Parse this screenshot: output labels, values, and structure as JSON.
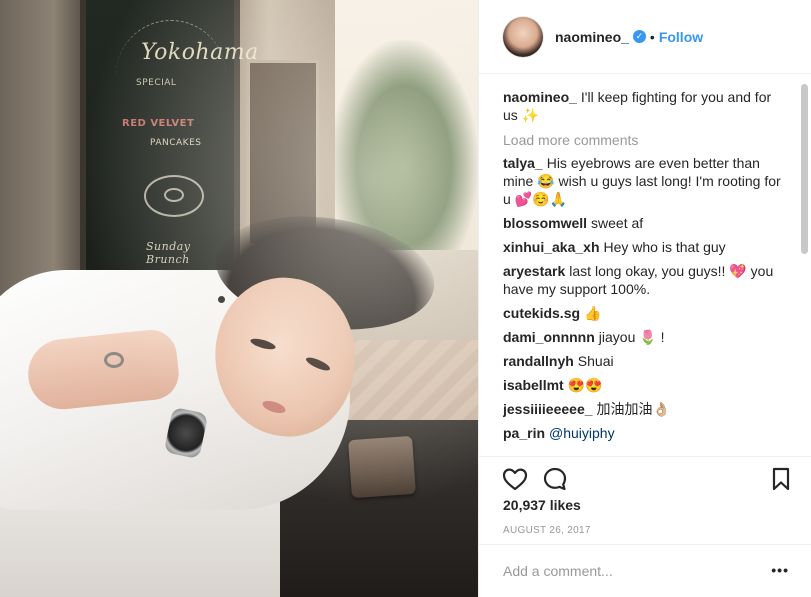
{
  "post": {
    "username": "naomineo_",
    "verified_icon": "verified-badge-icon",
    "separator": "•",
    "follow_label": "Follow"
  },
  "photo": {
    "chalkboard_title": "Yokohama",
    "chalkboard_sub": "SPECIAL",
    "chalkboard_red": "RED VELVET",
    "chalkboard_pancakes": "PANCAKES",
    "chalkboard_sign": "Sunday Brunch"
  },
  "caption": {
    "username": "naomineo_",
    "text": "I'll keep fighting for you and for us ✨"
  },
  "load_more_label": "Load more comments",
  "comments": [
    {
      "username": "talya_",
      "text": "His eyebrows are even better than mine 😂 wish u guys last long! I'm rooting for u 💕☺️🙏"
    },
    {
      "username": "blossomwell",
      "text": "sweet af"
    },
    {
      "username": "xinhui_aka_xh",
      "text": "Hey who is that guy"
    },
    {
      "username": "aryestark",
      "text": "last long okay, you guys!! 💖 you have my support 100%."
    },
    {
      "username": "cutekids.sg",
      "text": "👍"
    },
    {
      "username": "dami_onnnnn",
      "text": "jiayou 🌷 !"
    },
    {
      "username": "randallnyh",
      "text": "Shuai"
    },
    {
      "username": "isabellmt",
      "text": "😍😍"
    },
    {
      "username": "jessiiiieeeee_",
      "text": "加油加油👌🏼"
    },
    {
      "username": "pa_rin",
      "text": "",
      "mention": "@huiyiphy"
    }
  ],
  "actions": {
    "like_icon": "heart-icon",
    "comment_icon": "comment-bubble-icon",
    "save_icon": "bookmark-icon"
  },
  "likes": "20,937 likes",
  "date": "AUGUST 26, 2017",
  "add_comment": {
    "placeholder": "Add a comment...",
    "more_label": "•••"
  },
  "colors": {
    "accent": "#3897f0",
    "text": "#262626",
    "muted": "#999999",
    "border": "#efefef",
    "mention": "#003569"
  }
}
